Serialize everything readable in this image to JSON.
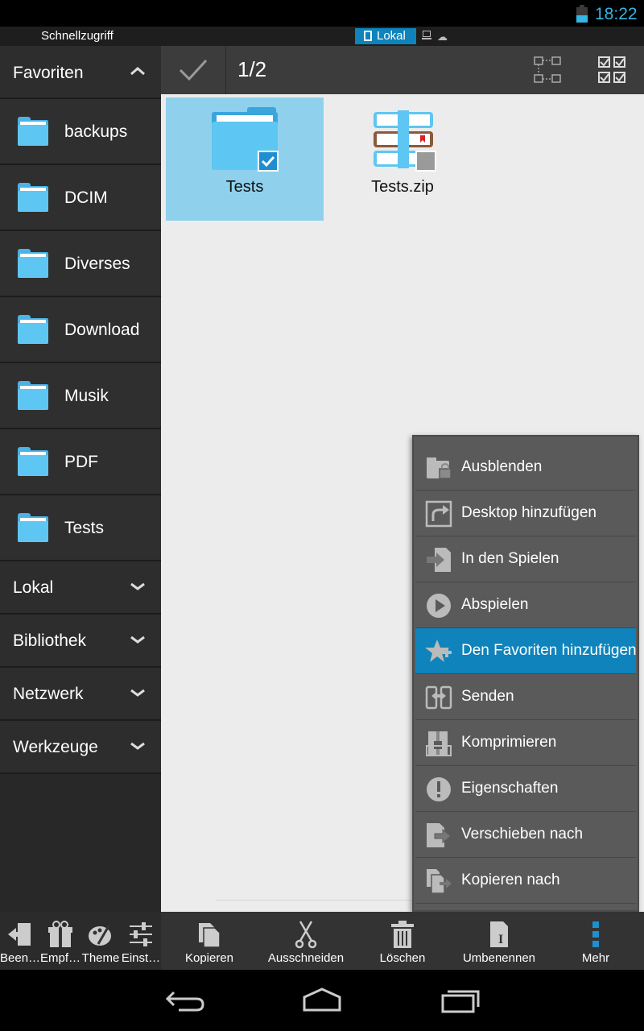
{
  "status": {
    "time": "18:22"
  },
  "quickbar": {
    "title": "Schnellzugriff",
    "active_location": "Lokal"
  },
  "sidebar": {
    "header": "Favoriten",
    "favorites": [
      {
        "label": "backups"
      },
      {
        "label": "DCIM"
      },
      {
        "label": "Diverses"
      },
      {
        "label": "Download"
      },
      {
        "label": "Musik"
      },
      {
        "label": "PDF"
      },
      {
        "label": "Tests"
      }
    ],
    "sections": [
      {
        "label": "Lokal"
      },
      {
        "label": "Bibliothek"
      },
      {
        "label": "Netzwerk"
      },
      {
        "label": "Werkzeuge"
      }
    ]
  },
  "toolbar": {
    "selection_count": "1/2"
  },
  "files": [
    {
      "name": "Tests",
      "type": "folder",
      "selected": true
    },
    {
      "name": "Tests.zip",
      "type": "archive",
      "selected": false
    }
  ],
  "context_menu": {
    "items": [
      {
        "label": "Ausblenden",
        "icon": "lock-folder-icon"
      },
      {
        "label": "Desktop hinzufügen",
        "icon": "share-arrow-icon"
      },
      {
        "label": "In den Spielen",
        "icon": "enter-icon"
      },
      {
        "label": "Abspielen",
        "icon": "play-icon"
      },
      {
        "label": "Den Favoriten hinzufügen",
        "icon": "star-plus-icon",
        "active": true
      },
      {
        "label": "Senden",
        "icon": "send-icon"
      },
      {
        "label": "Komprimieren",
        "icon": "archive-icon"
      },
      {
        "label": "Eigenschaften",
        "icon": "info-icon"
      },
      {
        "label": "Verschieben nach",
        "icon": "move-icon"
      },
      {
        "label": "Kopieren nach",
        "icon": "copy-to-icon"
      }
    ]
  },
  "actionbar": {
    "left": [
      {
        "label": "Been…"
      },
      {
        "label": "Empf…"
      },
      {
        "label": "Theme"
      },
      {
        "label": "Einst…"
      }
    ],
    "main": [
      {
        "label": "Kopieren"
      },
      {
        "label": "Ausschneiden"
      },
      {
        "label": "Löschen"
      },
      {
        "label": "Umbenennen"
      },
      {
        "label": "Mehr"
      }
    ]
  },
  "colors": {
    "accent": "#33b5e5",
    "selection_bg": "#8fd1ec",
    "menu_active": "#0f83bb"
  }
}
